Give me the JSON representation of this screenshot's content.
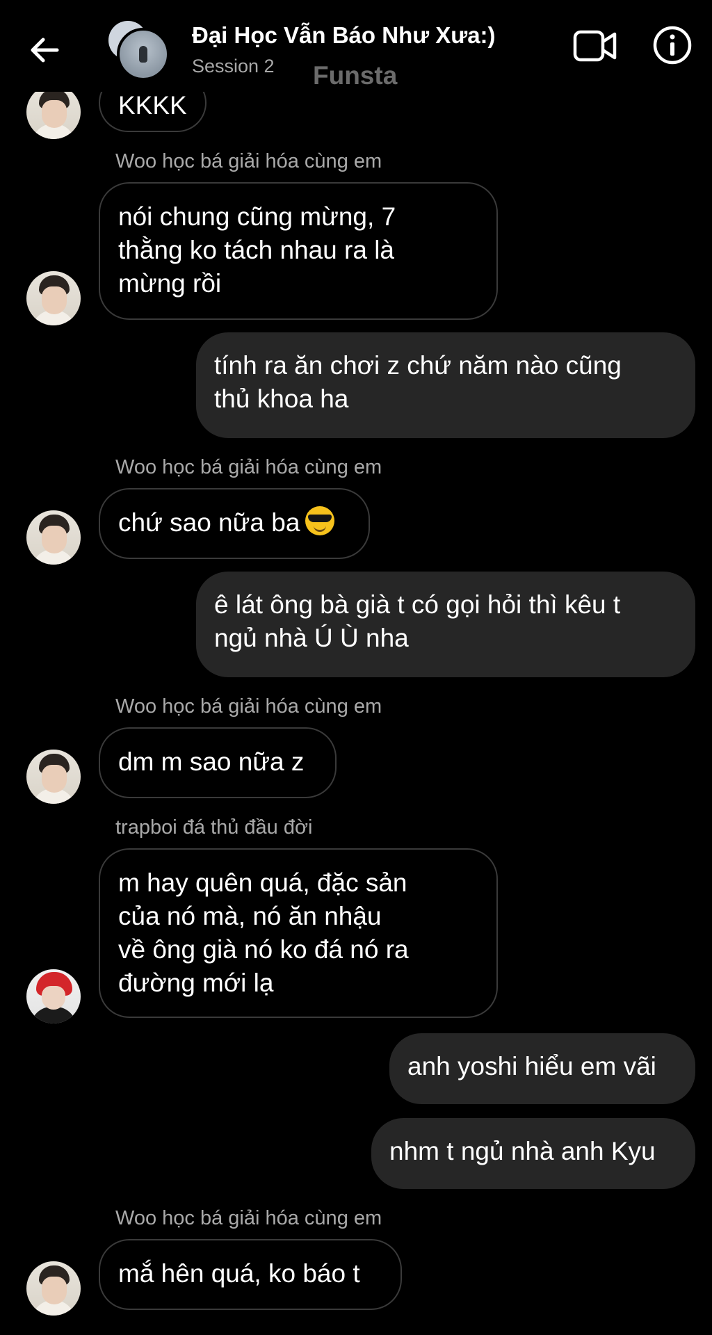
{
  "header": {
    "back_icon": "arrow-left-icon",
    "title": "Đại Học Vẫn Báo Như Xưa:)",
    "subtitle": "Session 2",
    "watermark": "Funsta",
    "video_icon": "video-camera-icon",
    "info_icon": "info-icon"
  },
  "messages": {
    "m0": {
      "text": "KKKK"
    },
    "m1": {
      "sender": "Woo học bá giải hóa cùng em",
      "lines": [
        "nói chung cũng mừng, 7",
        "thằng ko tách nhau ra là",
        "mừng rồi"
      ]
    },
    "m2": {
      "lines": [
        "tính ra ăn chơi z chứ năm nào cũng",
        "thủ khoa ha"
      ]
    },
    "m3": {
      "sender": "Woo học bá giải hóa cùng em",
      "text": "chứ sao nữa ba",
      "emoji": "smiling-face-with-sunglasses"
    },
    "m4": {
      "lines": [
        "ê lát ông bà già t có gọi hỏi thì kêu t",
        "ngủ nhà Ú Ù nha"
      ]
    },
    "m5": {
      "sender": "Woo học bá giải hóa cùng em",
      "text": "dm m sao nữa z"
    },
    "m6": {
      "sender": "trapboi đá thủ đầu đời",
      "lines": [
        "m hay quên quá, đặc sản",
        "của nó mà, nó ăn nhậu",
        "về ông già nó ko đá nó ra",
        "đường mới lạ"
      ]
    },
    "m7": {
      "text": "anh yoshi hiểu em vãi"
    },
    "m8": {
      "text": "nhm t ngủ nhà anh Kyu"
    },
    "m9": {
      "sender": "Woo học bá giải hóa cùng em",
      "text": "mắ hên quá, ko báo t"
    }
  }
}
